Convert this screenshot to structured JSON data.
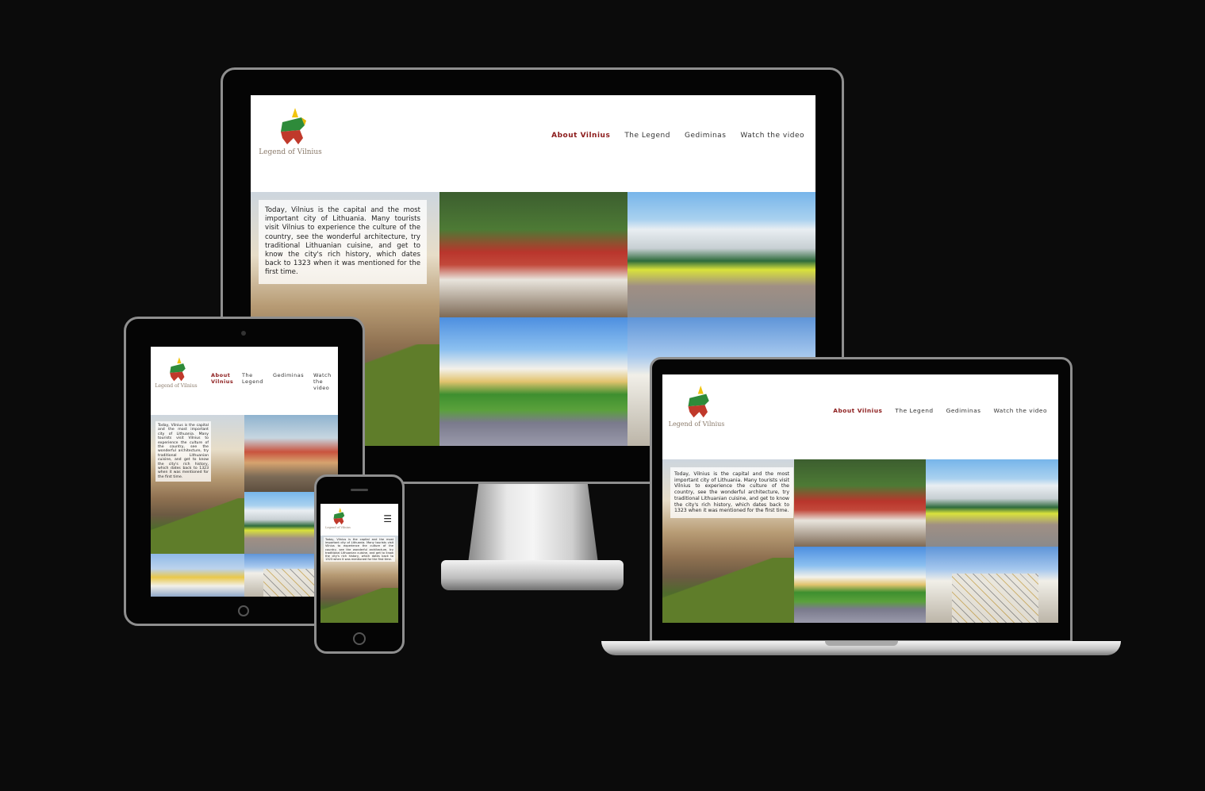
{
  "site": {
    "logo_text": "Legend of Vilnius",
    "nav": [
      {
        "label": "About Vilnius",
        "active": true
      },
      {
        "label": "The Legend",
        "active": false
      },
      {
        "label": "Gediminas",
        "active": false
      },
      {
        "label": "Watch the video",
        "active": false
      }
    ],
    "tablet_nav": [
      {
        "label": "About Vilnius",
        "active": true
      },
      {
        "label": "The Legend",
        "active": false
      },
      {
        "label": "Gediminas",
        "active": false
      },
      {
        "label": "Watch the video",
        "active": false
      }
    ],
    "intro": "Today, Vilnius is the capital and the most important city of Lithuania. Many tourists visit Vilnius to experience the culture of the country, see the wonderful architecture, try traditional Lithuanian cuisine, and get to know the city's rich history, which dates back to 1323 when it was mentioned for the first time.",
    "menu_glyph": "☰"
  },
  "colors": {
    "accent": "#8b1a1a",
    "background": "#0b0b0b",
    "text": "#333333"
  },
  "icons": [
    "wolf-logo-icon",
    "hamburger-menu-icon"
  ]
}
